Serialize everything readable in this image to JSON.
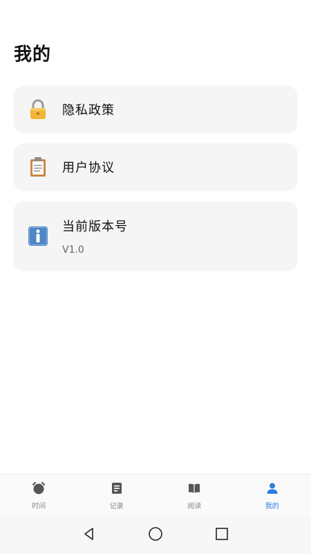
{
  "page": {
    "title": "我的"
  },
  "menu": {
    "items": [
      {
        "label": "隐私政策",
        "icon": "lock-icon"
      },
      {
        "label": "用户协议",
        "icon": "clipboard-icon"
      },
      {
        "label": "当前版本号",
        "icon": "info-icon",
        "value": "V1.0"
      }
    ]
  },
  "tabbar": {
    "active": "我的",
    "tabs": [
      {
        "label": "时间",
        "icon": "alarm-clock-icon"
      },
      {
        "label": "记录",
        "icon": "note-icon"
      },
      {
        "label": "阅读",
        "icon": "book-icon"
      },
      {
        "label": "我的",
        "icon": "person-icon"
      }
    ]
  },
  "colors": {
    "accent": "#2b7de0",
    "inactive": "#888888",
    "card_bg": "#f5f5f5"
  },
  "system_nav": {
    "buttons": [
      "back-icon",
      "home-icon",
      "recents-icon"
    ]
  }
}
